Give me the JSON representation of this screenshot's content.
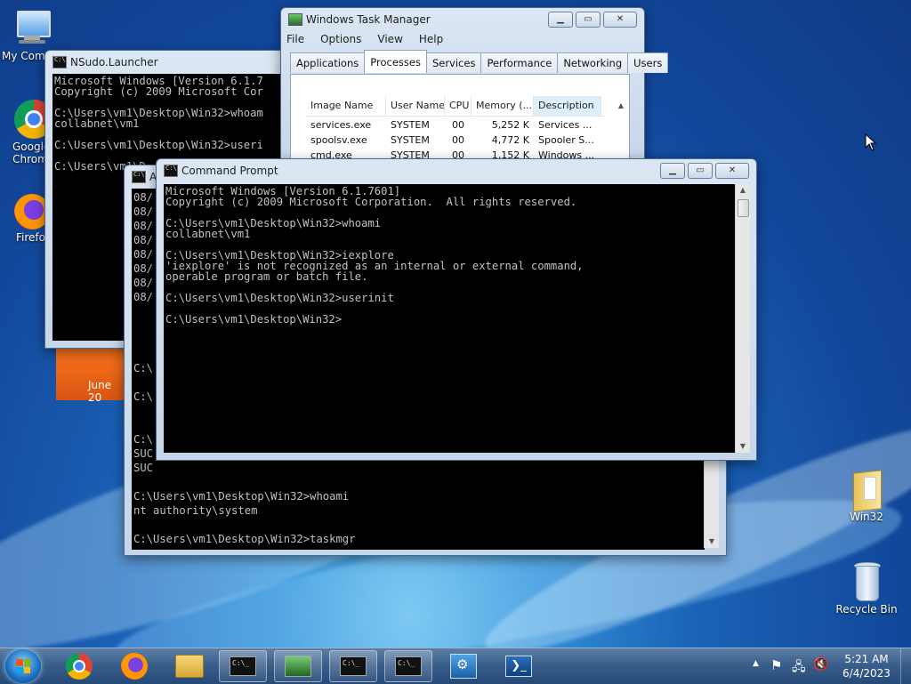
{
  "desktop": {
    "icons": [
      {
        "label": "My Comp",
        "icon": "computer-icon"
      },
      {
        "label": "Google Chrom",
        "icon": "chrome-icon"
      },
      {
        "label": "Firefo",
        "icon": "firefox-icon"
      },
      {
        "label": "Win32",
        "icon": "folder-icon"
      },
      {
        "label": "Recycle Bin",
        "icon": "recycle-bin-icon"
      }
    ],
    "calendar_gadget_text": "June 20"
  },
  "nsudo": {
    "title": "NSudo.Launcher",
    "lines": [
      "Microsoft Windows [Version 6.1.7",
      "Copyright (c) 2009 Microsoft Cor",
      "",
      "C:\\Users\\vm1\\Desktop\\Win32>whoam",
      "collabnet\\vm1",
      "",
      "C:\\Users\\vm1\\Desktop\\Win32>useri",
      "",
      "C:\\Users\\vm1\\D"
    ]
  },
  "admin_console": {
    "title_fragment": "A",
    "lines_fragment": [
      "08/",
      "08/",
      "08/",
      "08/",
      "08/",
      "08/",
      "08/",
      "08/",
      "",
      "",
      "",
      "",
      "C:\\",
      "",
      "C:\\",
      "",
      "",
      "C:\\",
      "SUC",
      "SUC"
    ],
    "bottom_lines": [
      "",
      "C:\\Users\\vm1\\Desktop\\Win32>whoami",
      "nt authority\\system",
      "",
      "C:\\Users\\vm1\\Desktop\\Win32>taskmgr",
      "",
      "C:\\Users\\vm1\\Desktop\\Win32>"
    ]
  },
  "taskmgr": {
    "title": "Windows Task Manager",
    "menu": [
      "File",
      "Options",
      "View",
      "Help"
    ],
    "tabs": [
      "Applications",
      "Processes",
      "Services",
      "Performance",
      "Networking",
      "Users"
    ],
    "active_tab": "Processes",
    "columns": [
      "Image Name",
      "User Name",
      "CPU",
      "Memory (...",
      "Description"
    ],
    "rows": [
      [
        "services.exe",
        "SYSTEM",
        "00",
        "5,252 K",
        "Services ..."
      ],
      [
        "spoolsv.exe",
        "SYSTEM",
        "00",
        "4,772 K",
        "Spooler S..."
      ],
      [
        "cmd.exe",
        "SYSTEM",
        "00",
        "1,152 K",
        "Windows ..."
      ]
    ]
  },
  "cmd": {
    "title": "Command Prompt",
    "lines": [
      "Microsoft Windows [Version 6.1.7601]",
      "Copyright (c) 2009 Microsoft Corporation.  All rights reserved.",
      "",
      "C:\\Users\\vm1\\Desktop\\Win32>whoami",
      "collabnet\\vm1",
      "",
      "C:\\Users\\vm1\\Desktop\\Win32>iexplore",
      "'iexplore' is not recognized as an internal or external command,",
      "operable program or batch file.",
      "",
      "C:\\Users\\vm1\\Desktop\\Win32>userinit",
      "",
      "C:\\Users\\vm1\\Desktop\\Win32>"
    ]
  },
  "taskbar": {
    "buttons": [
      "start-orb",
      "chrome",
      "firefox",
      "explorer",
      "cmd",
      "task-manager",
      "cmd",
      "cmd",
      "services",
      "powershell"
    ],
    "time": "5:21 AM",
    "date": "6/4/2023"
  },
  "colors": {
    "console_bg": "#000000",
    "console_text": "#c0c0c0",
    "gadget": "#e8641c"
  }
}
